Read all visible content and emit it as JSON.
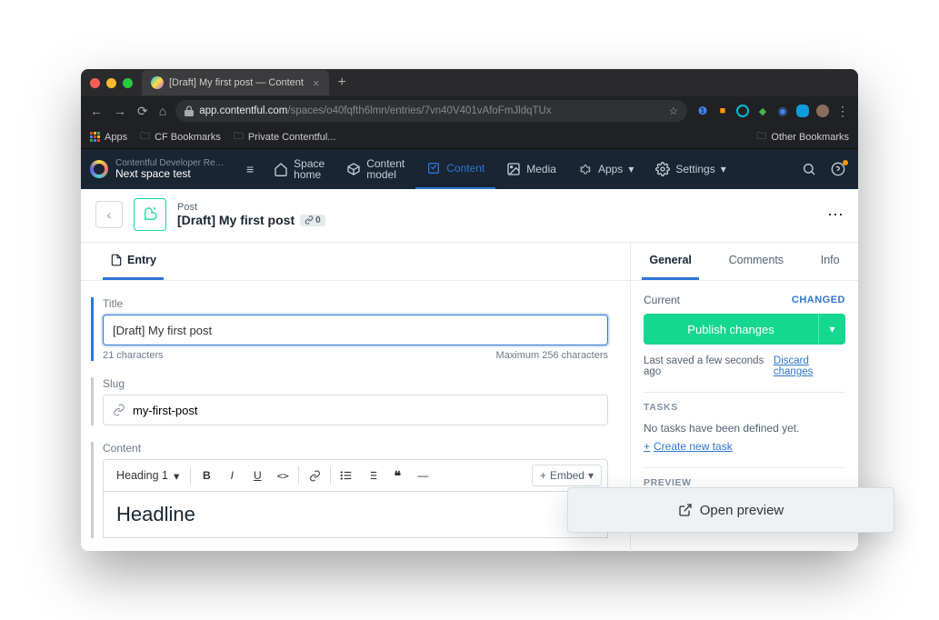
{
  "browser": {
    "tab_title": "[Draft] My first post — Content",
    "domain": "app.contentful.com",
    "path": "/spaces/o40fqfth6lmn/entries/7vn40V401vAfoFmJldqTUx",
    "bookmarks_label": "Apps",
    "bookmark_items": [
      "CF Bookmarks",
      "Private Contentful..."
    ],
    "other_bookmarks": "Other Bookmarks"
  },
  "header": {
    "org": "Contentful Developer Rel...",
    "space": "Next space test",
    "nav": {
      "space_home": "Space home",
      "content_model": "Content model",
      "content": "Content",
      "media": "Media",
      "apps": "Apps",
      "settings": "Settings"
    }
  },
  "breadcrumb": {
    "type": "Post",
    "title": "[Draft] My first post",
    "refs_count": "0"
  },
  "editor": {
    "entry_tab": "Entry",
    "fields": {
      "title": {
        "label": "Title",
        "value": "[Draft] My first post",
        "count": "21 characters",
        "max": "Maximum 256 characters"
      },
      "slug": {
        "label": "Slug",
        "value": "my-first-post"
      },
      "content": {
        "label": "Content",
        "heading_style": "Heading 1",
        "embed": "Embed",
        "body_text": "Headline"
      }
    }
  },
  "sidebar": {
    "tabs": {
      "general": "General",
      "comments": "Comments",
      "info": "Info"
    },
    "status_label": "Current",
    "status_value": "CHANGED",
    "publish_btn": "Publish changes",
    "last_saved": "Last saved a few seconds ago",
    "discard": "Discard changes",
    "tasks_title": "TASKS",
    "tasks_empty": "No tasks have been defined yet.",
    "create_task": "Create new task",
    "preview_title": "PREVIEW",
    "open_preview": "Open preview"
  }
}
